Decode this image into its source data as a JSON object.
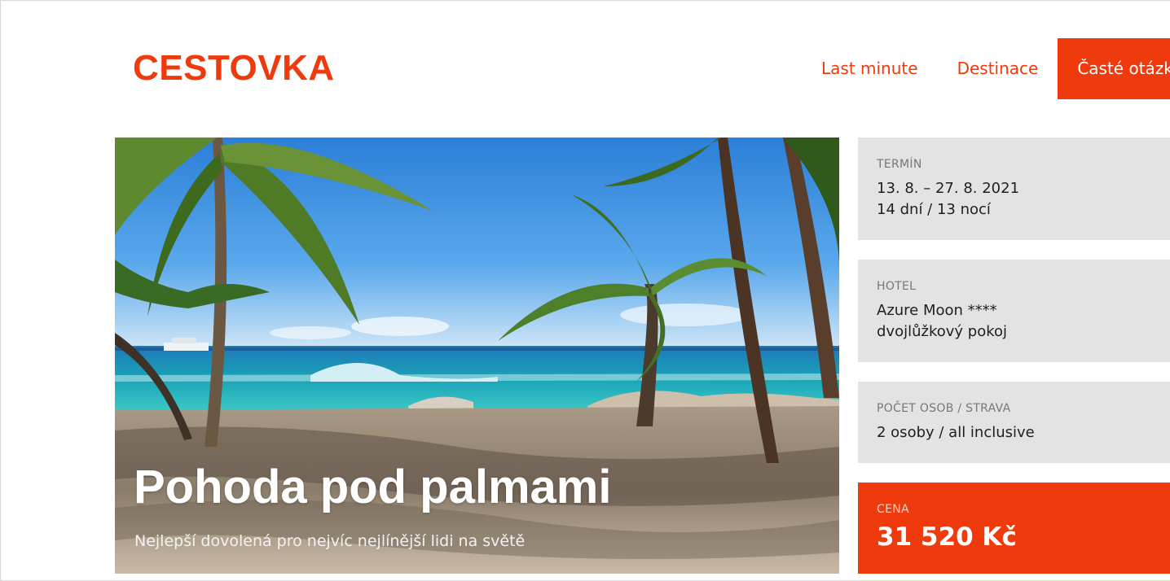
{
  "logo": "CESTOVKA",
  "nav": {
    "items": [
      "Last minute",
      "Destinace"
    ],
    "cta": "Časté otázky"
  },
  "hero": {
    "title": "Pohoda pod palmami",
    "subtitle": "Nejlepší dovolená pro nejvíc nejlínější lidi na světě",
    "image": "beach-palms-photo"
  },
  "info": {
    "term": {
      "label": "TERMÍN",
      "line1": "13. 8. – 27. 8. 2021",
      "line2": "14 dní / 13 nocí"
    },
    "hotel": {
      "label": "HOTEL",
      "line1": "Azure Moon ****",
      "line2": "dvojlůžkový pokoj"
    },
    "persons": {
      "label": "POČET OSOB / STRAVA",
      "line1": "2 osoby / all inclusive"
    },
    "price": {
      "label": "CENA",
      "value": "31 520 Kč"
    }
  },
  "colors": {
    "brand": "#ee3a0c",
    "card_bg": "#e3e3e3"
  }
}
